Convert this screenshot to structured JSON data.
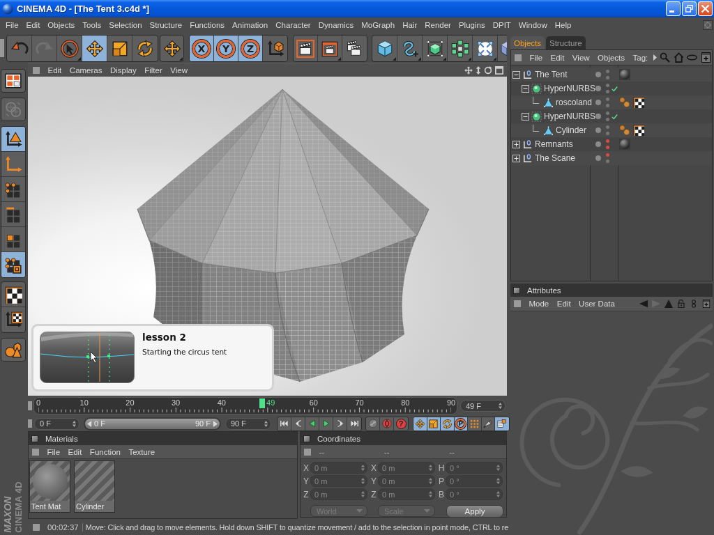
{
  "window": {
    "title": "CINEMA 4D - [The Tent 3.c4d *]"
  },
  "menu_bar": [
    "File",
    "Edit",
    "Objects",
    "Tools",
    "Selection",
    "Structure",
    "Functions",
    "Animation",
    "Character",
    "Dynamics",
    "MoGraph",
    "Hair",
    "Render",
    "Plugins",
    "DPIT",
    "Window",
    "Help"
  ],
  "toolbar": [
    {
      "selected": false,
      "disabled": false
    },
    {
      "selected": false,
      "disabled": true
    },
    {
      "selected": false,
      "disabled": false
    },
    {
      "selected": true,
      "disabled": false
    },
    {
      "selected": false,
      "disabled": false
    },
    {
      "selected": false,
      "disabled": false
    },
    {
      "selected": false,
      "disabled": false
    },
    {
      "glyph": "X",
      "selected": true,
      "disabled": false
    },
    {
      "glyph": "Y",
      "selected": true,
      "disabled": false
    },
    {
      "glyph": "Z",
      "selected": true,
      "disabled": false
    },
    {
      "selected": false,
      "disabled": false
    },
    {
      "selected": false,
      "disabled": false
    },
    {
      "selected": false,
      "disabled": false
    },
    {
      "selected": false,
      "disabled": false
    },
    {
      "selected": false,
      "disabled": false
    },
    {
      "selected": false,
      "disabled": false
    },
    {
      "selected": false,
      "disabled": false
    },
    {
      "selected": false,
      "disabled": false
    },
    {
      "selected": false,
      "disabled": false
    },
    {
      "selected": false,
      "disabled": false
    }
  ],
  "objects_panel": {
    "tabs": [
      {
        "label": "Objects",
        "selected": true
      },
      {
        "label": "Structure",
        "selected": false
      }
    ],
    "menu": [
      "File",
      "Edit",
      "View",
      "Objects",
      "Tag:"
    ],
    "tree": [
      {
        "name": "The Tent",
        "kind": "null",
        "expanded": true,
        "editor_off": false,
        "render_off": false,
        "check": false,
        "tags": [
          {
            "kind": "material"
          }
        ],
        "children": [
          {
            "name": "HyperNURBS",
            "kind": "hypernurbs",
            "expanded": true,
            "editor_off": false,
            "render_off": false,
            "check": true,
            "children": [
              {
                "name": "roscoland",
                "kind": "polygon",
                "editor_off": false,
                "render_off": false,
                "check": false,
                "tags": [
                  {
                    "kind": "phong"
                  },
                  {
                    "kind": "texture"
                  }
                ]
              }
            ]
          },
          {
            "name": "HyperNURBS",
            "kind": "hypernurbs",
            "expanded": true,
            "editor_off": false,
            "render_off": false,
            "check": true,
            "children": [
              {
                "name": "Cylinder",
                "kind": "polygon",
                "editor_off": false,
                "render_off": false,
                "check": false,
                "tags": [
                  {
                    "kind": "phong"
                  },
                  {
                    "kind": "texture"
                  }
                ]
              }
            ]
          }
        ]
      },
      {
        "name": "Remnants",
        "kind": "null",
        "expanded": false,
        "editor_off": true,
        "render_off": true,
        "check": false,
        "tags": [
          {
            "kind": "material"
          }
        ]
      },
      {
        "name": "The Scane",
        "kind": "null",
        "expanded": false,
        "editor_off": true,
        "render_off": false,
        "check": false
      }
    ]
  },
  "tool_palette": [
    {
      "selected": false,
      "disabled": false
    },
    {
      "selected": false,
      "disabled": true
    },
    {
      "selected": true,
      "disabled": false
    },
    {
      "selected": false,
      "disabled": false
    },
    {
      "selected": false,
      "disabled": false
    },
    {
      "selected": false,
      "disabled": false
    },
    {
      "selected": false,
      "disabled": false
    },
    {
      "selected": true,
      "disabled": false
    },
    {
      "selected": false,
      "disabled": false
    },
    {
      "selected": false,
      "disabled": false
    },
    {
      "selected": false,
      "disabled": false
    }
  ],
  "viewport": {
    "menu": [
      "Edit",
      "Cameras",
      "Display",
      "Filter",
      "View"
    ],
    "lesson": {
      "title": "lesson 2",
      "subtitle": "Starting the circus tent"
    }
  },
  "attributes_panel": {
    "title": "Attributes",
    "menu": [
      "Mode",
      "Edit",
      "User Data"
    ],
    "nav": [
      {
        "disabled": false
      },
      {
        "disabled": true
      },
      {
        "disabled": false
      }
    ]
  },
  "timeline": {
    "labels": [
      {
        "text": "0",
        "level": 0
      },
      {
        "text": "10",
        "level": 0.111
      },
      {
        "text": "20",
        "level": 0.222
      },
      {
        "text": "30",
        "level": 0.333
      },
      {
        "text": "40",
        "level": 0.444
      },
      {
        "text": "60",
        "level": 0.667
      },
      {
        "text": "70",
        "level": 0.778
      },
      {
        "text": "80",
        "level": 0.889
      },
      {
        "text": "90",
        "level": 1
      }
    ],
    "current": {
      "label": "49",
      "level": 0.544
    },
    "frame_field": "49 F"
  },
  "transport": {
    "start_field": "0 F",
    "range": {
      "start": "0 F",
      "end": "90 F",
      "level": 1
    },
    "end_field": "90 F",
    "record_buttons": [
      {
        "kind": "link"
      },
      {
        "kind": "record"
      },
      {
        "kind": "help",
        "glyph": "?"
      }
    ],
    "key_buttons": [
      {
        "selected": true
      },
      {
        "selected": true
      },
      {
        "selected": true
      },
      {
        "selected": true,
        "glyph": "P"
      },
      {
        "selected": false
      },
      {
        "selected": false
      },
      {
        "selected": true
      }
    ]
  },
  "materials": {
    "title": "Materials",
    "menu": [
      "File",
      "Edit",
      "Function",
      "Texture"
    ],
    "items": [
      {
        "name": "Tent Mat",
        "kind": "sphere"
      },
      {
        "name": "Cylinder",
        "kind": "blank"
      }
    ]
  },
  "coordinates": {
    "title": "Coordinates",
    "columns": [
      "--",
      "--",
      "--"
    ],
    "rows": [
      {
        "cells": [
          {
            "axis": "X",
            "value": "0 m"
          },
          {
            "axis": "X",
            "value": "0 m"
          },
          {
            "axis": "H",
            "value": "0 °"
          }
        ]
      },
      {
        "cells": [
          {
            "axis": "Y",
            "value": "0 m"
          },
          {
            "axis": "Y",
            "value": "0 m"
          },
          {
            "axis": "P",
            "value": "0 °"
          }
        ]
      },
      {
        "cells": [
          {
            "axis": "Z",
            "value": "0 m"
          },
          {
            "axis": "Z",
            "value": "0 m"
          },
          {
            "axis": "B",
            "value": "0 °"
          }
        ]
      }
    ],
    "dropdowns": [
      {
        "label": "World",
        "disabled": true
      },
      {
        "label": "Scale",
        "disabled": true
      }
    ],
    "apply": "Apply"
  },
  "status_bar": {
    "time": "00:02:37",
    "message": "Move: Click and drag to move elements. Hold down SHIFT to quantize movement / add to the selection in point mode, CTRL to re"
  },
  "logo": {
    "brand": "MAXON",
    "product": "CINEMA 4D"
  }
}
